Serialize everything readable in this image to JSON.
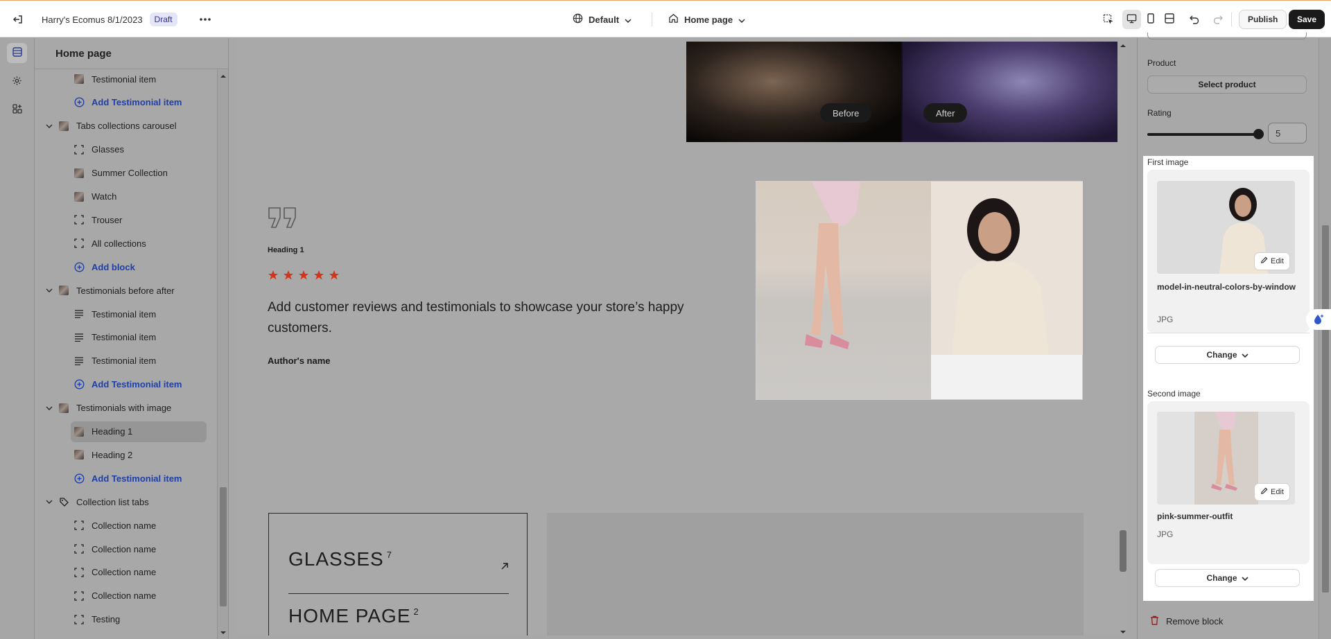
{
  "topbar": {
    "store_name": "Harry's Ecomus 8/1/2023",
    "status_badge": "Draft",
    "theme_dropdown": "Default",
    "page_dropdown": "Home page",
    "publish_label": "Publish",
    "save_label": "Save",
    "icons": [
      "exit-icon",
      "more-icon",
      "globe-icon",
      "home-icon",
      "inspector-icon",
      "desktop-icon",
      "mobile-icon",
      "fullwidth-icon",
      "undo-icon",
      "redo-icon"
    ]
  },
  "rail": {
    "items": [
      "sections-icon",
      "settings-icon",
      "apps-icon"
    ]
  },
  "sidebar": {
    "title": "Home page",
    "rows": [
      {
        "label": "Testimonial item",
        "type": "item",
        "icon": "image-thumb"
      },
      {
        "label": "Add Testimonial item",
        "type": "add"
      },
      {
        "label": "Tabs collections carousel",
        "type": "section"
      },
      {
        "label": "Glasses",
        "type": "item",
        "icon": "dashed-square-icon"
      },
      {
        "label": "Summer Collection",
        "type": "item",
        "icon": "image-thumb"
      },
      {
        "label": "Watch",
        "type": "item",
        "icon": "image-thumb"
      },
      {
        "label": "Trouser",
        "type": "item",
        "icon": "dashed-square-icon"
      },
      {
        "label": "All collections",
        "type": "item",
        "icon": "dashed-square-icon"
      },
      {
        "label": "Add block",
        "type": "add"
      },
      {
        "label": "Testimonials before after",
        "type": "section"
      },
      {
        "label": "Testimonial item",
        "type": "item",
        "icon": "text-lines-icon"
      },
      {
        "label": "Testimonial item",
        "type": "item",
        "icon": "text-lines-icon"
      },
      {
        "label": "Testimonial item",
        "type": "item",
        "icon": "text-lines-icon"
      },
      {
        "label": "Add Testimonial item",
        "type": "add"
      },
      {
        "label": "Testimonials with image",
        "type": "section"
      },
      {
        "label": "Heading 1",
        "type": "item",
        "icon": "image-thumb",
        "selected": true
      },
      {
        "label": "Heading 2",
        "type": "item",
        "icon": "image-thumb"
      },
      {
        "label": "Add Testimonial item",
        "type": "add"
      },
      {
        "label": "Collection list tabs",
        "type": "section",
        "icon": "tag-icon"
      },
      {
        "label": "Collection name",
        "type": "item",
        "icon": "dashed-square-icon"
      },
      {
        "label": "Collection name",
        "type": "item",
        "icon": "dashed-square-icon"
      },
      {
        "label": "Collection name",
        "type": "item",
        "icon": "dashed-square-icon"
      },
      {
        "label": "Collection name",
        "type": "item",
        "icon": "dashed-square-icon"
      },
      {
        "label": "Testing",
        "type": "item",
        "icon": "dashed-square-icon"
      }
    ]
  },
  "preview": {
    "before_label": "Before",
    "after_label": "After",
    "testimonial": {
      "heading": "Heading 1",
      "rating": 5,
      "text": "Add customer reviews and testimonials to showcase your store’s happy customers.",
      "author": "Author's name"
    },
    "collections": [
      {
        "name": "GLASSES",
        "count": "7"
      },
      {
        "name": "HOME PAGE",
        "count": "2"
      }
    ]
  },
  "panel": {
    "product_label": "Product",
    "select_product_label": "Select product",
    "rating_label": "Rating",
    "rating_value": "5",
    "rating_level": 5,
    "first_image": {
      "section_label": "First image",
      "filename": "model-in-neutral-colors-by-window",
      "filetype": "JPG",
      "edit_label": "Edit",
      "change_label": "Change"
    },
    "second_image": {
      "section_label": "Second image",
      "filename": "pink-summer-outfit",
      "filetype": "JPG",
      "edit_label": "Edit",
      "change_label": "Change"
    },
    "remove_label": "Remove block"
  },
  "colors": {
    "accent_link": "#1f3fa8",
    "star": "#d4341a",
    "primary_button": "#1a1a1a"
  }
}
